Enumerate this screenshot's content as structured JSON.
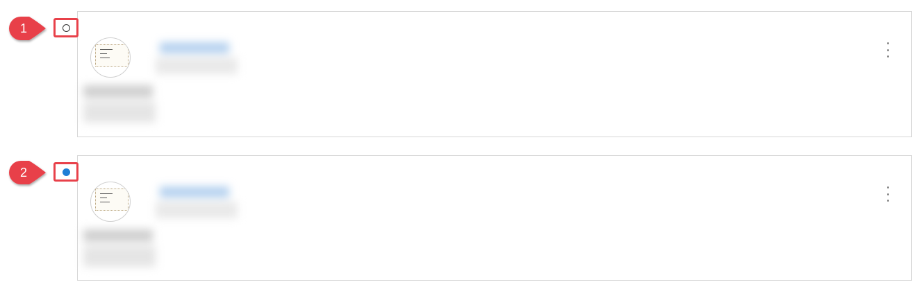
{
  "steps": [
    {
      "number": "1",
      "radio_selected": false,
      "card": {
        "avatar_icon": "document-thumbnail-icon",
        "menu_icon": "more-vertical-icon"
      }
    },
    {
      "number": "2",
      "radio_selected": true,
      "card": {
        "avatar_icon": "document-thumbnail-icon",
        "menu_icon": "more-vertical-icon"
      }
    }
  ],
  "colors": {
    "callout_red": "#e8414a",
    "radio_selected_blue": "#1e7fd6",
    "card_border": "#d6d6d6",
    "blurred_name_tint": "#9cc2ea"
  }
}
